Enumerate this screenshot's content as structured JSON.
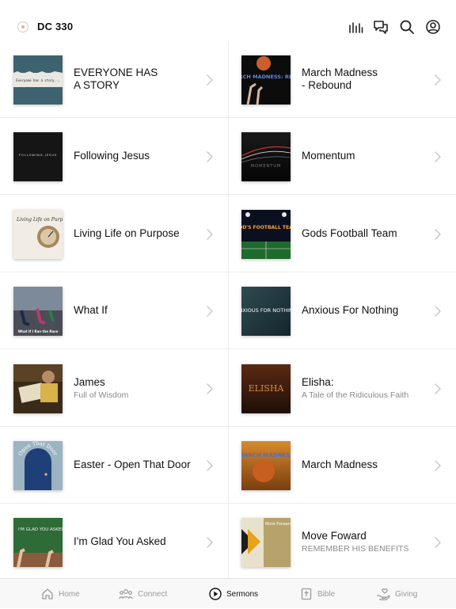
{
  "header": {
    "title": "DC 330"
  },
  "icons": {
    "listen": "bars-chart-icon",
    "messages": "chat-bubbles-icon",
    "search": "search-icon",
    "profile": "user-circle-icon"
  },
  "series": [
    {
      "title": "EVERYONE HAS\nA STORY",
      "subtitle": "",
      "thumb_text": "Everyone has a story..."
    },
    {
      "title": "March Madness\n- Rebound",
      "subtitle": "",
      "thumb_text": "MARCH MADNESS: REBOUND"
    },
    {
      "title": "Following Jesus",
      "subtitle": "",
      "thumb_text": "FOLLOWING JESUS"
    },
    {
      "title": "Momentum",
      "subtitle": "",
      "thumb_text": "MOMENTUM"
    },
    {
      "title": "Living Life on Purpose",
      "subtitle": "",
      "thumb_text": "Living Life on Purpose"
    },
    {
      "title": "Gods Football Team",
      "subtitle": "",
      "thumb_text": "GOD'S FOOTBALL TEAM"
    },
    {
      "title": "What If",
      "subtitle": "",
      "thumb_text": "What If I Ran the Race"
    },
    {
      "title": "Anxious For Nothing",
      "subtitle": "",
      "thumb_text": "ANXIOUS FOR NOTHING"
    },
    {
      "title": "James",
      "subtitle": "Full of Wisdom",
      "thumb_text": ""
    },
    {
      "title": "Elisha:",
      "subtitle": "A Tale of the Ridiculous Faith",
      "thumb_text": "ELISHA"
    },
    {
      "title": "Easter - Open That Door",
      "subtitle": "",
      "thumb_text": "Open That Door"
    },
    {
      "title": "March Madness",
      "subtitle": "",
      "thumb_text": "MARCH MADNESS"
    },
    {
      "title": "I'm Glad You Asked",
      "subtitle": "",
      "thumb_text": "I'M GLAD YOU ASKED"
    },
    {
      "title": "Move Foward",
      "subtitle": "REMEMBER HIS BENEFITS",
      "thumb_text": "Move Forward"
    }
  ],
  "tabs": [
    {
      "label": "Home",
      "icon": "home-icon",
      "active": false
    },
    {
      "label": "Connect",
      "icon": "people-icon",
      "active": false
    },
    {
      "label": "Sermons",
      "icon": "play-circle-icon",
      "active": true
    },
    {
      "label": "Bible",
      "icon": "bible-icon",
      "active": false
    },
    {
      "label": "Giving",
      "icon": "giving-hand-icon",
      "active": false
    }
  ]
}
